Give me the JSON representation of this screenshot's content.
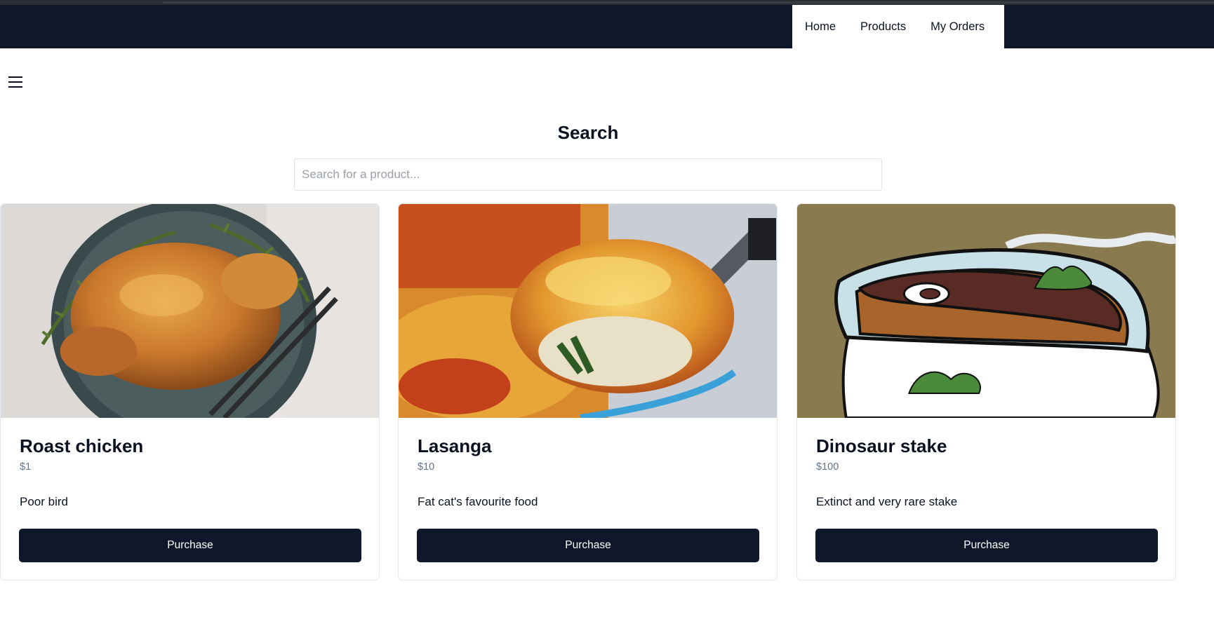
{
  "nav": {
    "items": [
      {
        "label": "Home"
      },
      {
        "label": "Products"
      },
      {
        "label": "My Orders"
      }
    ]
  },
  "menu_icon": "hamburger-menu-icon",
  "search": {
    "title": "Search",
    "placeholder": "Search for a product...",
    "value": ""
  },
  "products": [
    {
      "name": "Roast chicken",
      "price": "$1",
      "description": "Poor bird",
      "button_label": "Purchase",
      "image": "roast-chicken-photo"
    },
    {
      "name": "Lasanga",
      "price": "$10",
      "description": "Fat cat's favourite food",
      "button_label": "Purchase",
      "image": "lasagna-photo"
    },
    {
      "name": "Dinosaur stake",
      "price": "$100",
      "description": "Extinct and very rare stake",
      "button_label": "Purchase",
      "image": "cartoon-dinosaur-steak-image"
    }
  ],
  "colors": {
    "navbar": "#0f172a",
    "button": "#0f172a",
    "price_text": "#64748b"
  }
}
